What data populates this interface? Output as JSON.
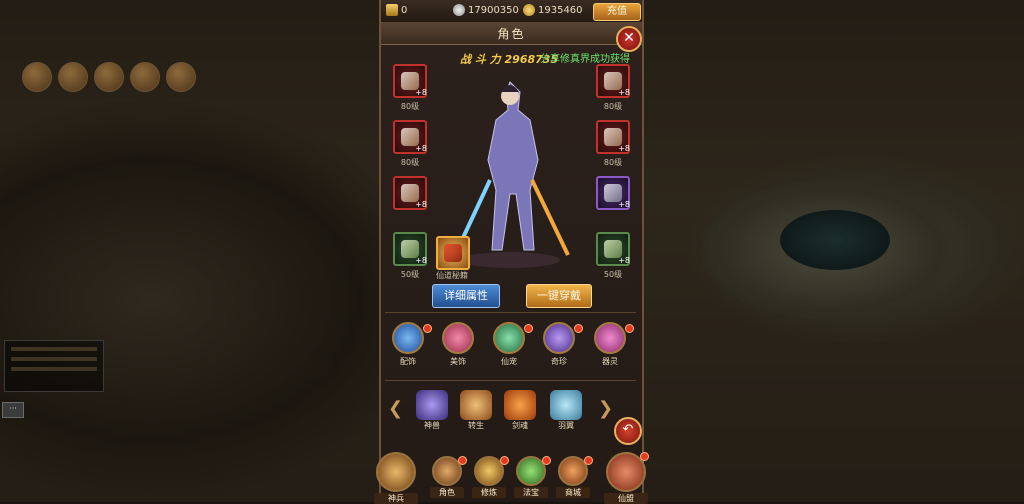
{
  "currencies": {
    "ingots": "0",
    "silver": "17900350",
    "gold": "1935460",
    "recharge_label": "充值"
  },
  "window": {
    "title": "角色",
    "close_label": "✕"
  },
  "combat": {
    "label": "战 斗 力",
    "value": "2968735",
    "ticker": "分享修真界成功获得"
  },
  "equipment": {
    "left": [
      {
        "name": "weapon",
        "level": "80级",
        "plus": "+8",
        "rarity": "red"
      },
      {
        "name": "armor",
        "level": "80级",
        "plus": "+8",
        "rarity": "red"
      },
      {
        "name": "bracer",
        "level": "",
        "plus": "+8",
        "rarity": "red"
      },
      {
        "name": "ring",
        "level": "50级",
        "plus": "+8",
        "rarity": "green"
      }
    ],
    "right": [
      {
        "name": "helmet",
        "level": "80级",
        "plus": "+8",
        "rarity": "red"
      },
      {
        "name": "shoulder",
        "level": "80级",
        "plus": "+8",
        "rarity": "red"
      },
      {
        "name": "boots",
        "level": "",
        "plus": "+8",
        "rarity": "purple"
      },
      {
        "name": "necklace",
        "level": "50级",
        "plus": "+8",
        "rarity": "green"
      }
    ],
    "special_label": "仙道秘籍"
  },
  "actions": {
    "details": "详细属性",
    "equip_all": "一键穿戴"
  },
  "features": [
    {
      "label": "配饰",
      "color": "#3a7ad8"
    },
    {
      "label": "美饰",
      "color": "#d84a6a"
    },
    {
      "label": "仙宠",
      "color": "#4ab87a"
    },
    {
      "label": "奇珍",
      "color": "#8a5ad8"
    },
    {
      "label": "器灵",
      "color": "#d84aa0"
    }
  ],
  "pets": [
    {
      "label": "神兽",
      "color": "#7a6ad8"
    },
    {
      "label": "转生",
      "color": "#d8883a"
    },
    {
      "label": "剑魂",
      "color": "#e87a2a"
    },
    {
      "label": "羽翼",
      "color": "#5ab0d8"
    }
  ],
  "bottom_nav": [
    {
      "label": "神兵",
      "color": "#c48a3a"
    },
    {
      "label": "角色",
      "color": "#b8743a"
    },
    {
      "label": "修炼",
      "color": "#d8a84a"
    },
    {
      "label": "法宝",
      "color": "#6ab04a"
    },
    {
      "label": "商城",
      "color": "#d87a3a"
    },
    {
      "label": "仙盟",
      "color": "#c85a3a"
    }
  ]
}
